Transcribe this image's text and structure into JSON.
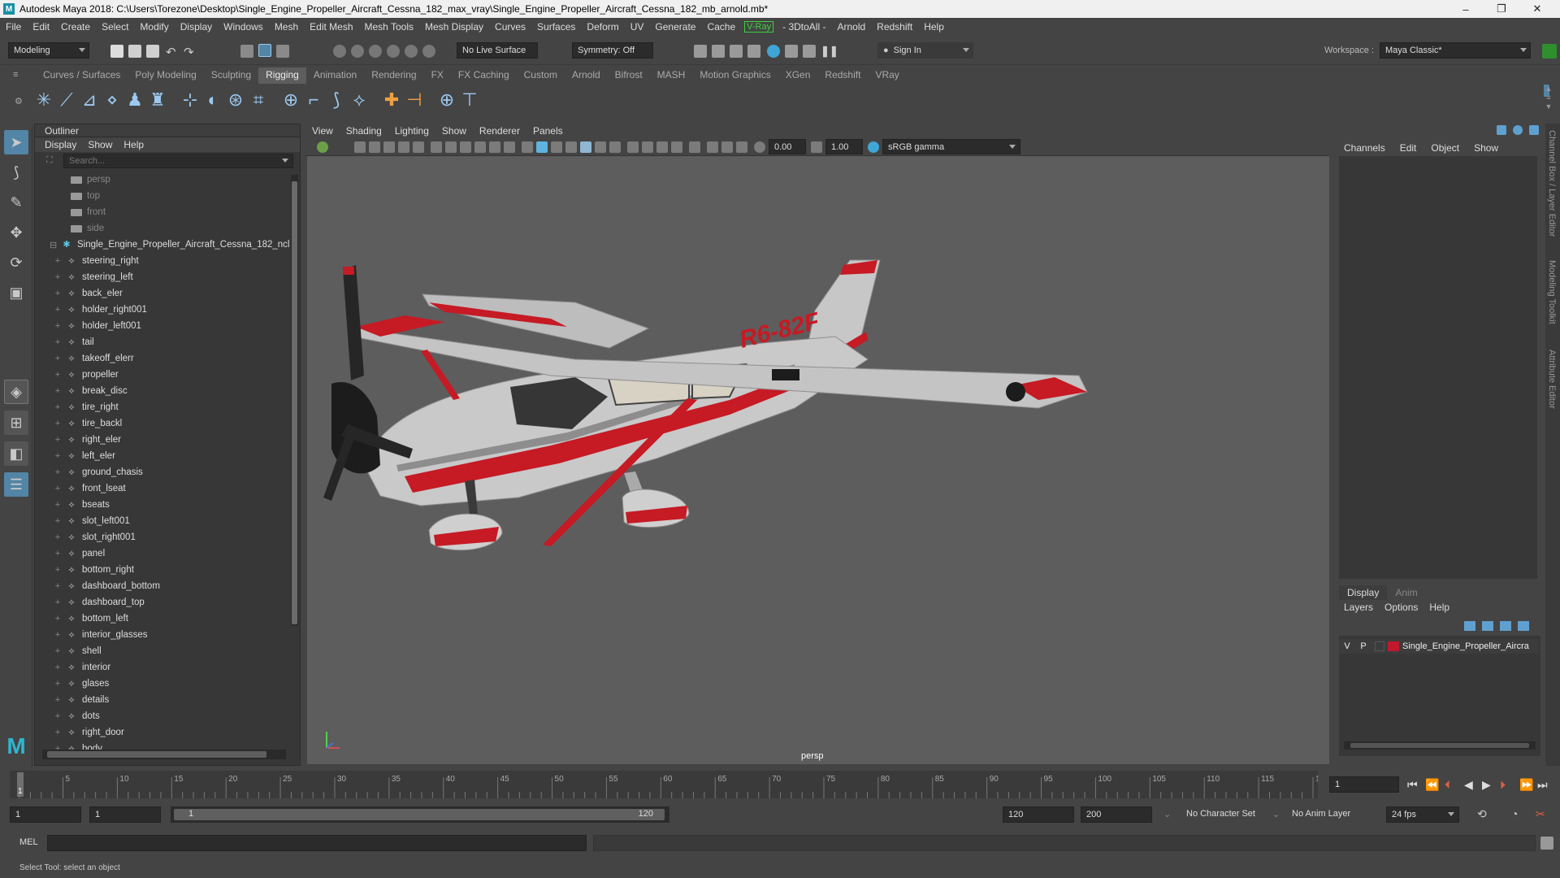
{
  "window": {
    "title": "Autodesk Maya 2018: C:\\Users\\Torezone\\Desktop\\Single_Engine_Propeller_Aircraft_Cessna_182_max_vray\\Single_Engine_Propeller_Aircraft_Cessna_182_mb_arnold.mb*",
    "minimize": "–",
    "restore": "❐",
    "close": "✕"
  },
  "menubar": {
    "items": [
      "File",
      "Edit",
      "Create",
      "Select",
      "Modify",
      "Display",
      "Windows",
      "Mesh",
      "Edit Mesh",
      "Mesh Tools",
      "Mesh Display",
      "Curves",
      "Surfaces",
      "Deform",
      "UV",
      "Generate",
      "Cache"
    ],
    "vray": "V-Ray",
    "items2": [
      "- 3DtoAll -",
      "Arnold",
      "Redshift",
      "Help"
    ],
    "workspace_label": "Workspace :",
    "workspace_value": "Maya Classic*"
  },
  "statusline": {
    "mode": "Modeling",
    "live_surface": "No Live Surface",
    "symmetry": "Symmetry: Off",
    "sign_in": "Sign In"
  },
  "shelf": {
    "tabs": [
      "Curves / Surfaces",
      "Poly Modeling",
      "Sculpting",
      "Rigging",
      "Animation",
      "Rendering",
      "FX",
      "FX Caching",
      "Custom",
      "Arnold",
      "Bifrost",
      "MASH",
      "Motion Graphics",
      "XGen",
      "Redshift",
      "VRay"
    ],
    "active_tab": "Rigging",
    "icons": [
      "joint-tool-icon",
      "insert-joint-icon",
      "mirror-joint-icon",
      "orient-joint-icon",
      "quick-rig-icon",
      "humanik-icon",
      "bind-skin-icon",
      "paint-weights-icon",
      "smooth-bind-icon",
      "lattice-icon",
      "cluster-icon",
      "ik-handle-icon",
      "ik-spline-icon",
      "ik-spring-icon",
      "point-constraint-icon",
      "aim-constraint-icon",
      "parent-constraint-icon",
      "locator-icon"
    ]
  },
  "outliner": {
    "title": "Outliner",
    "menu": [
      "Display",
      "Show",
      "Help"
    ],
    "search_placeholder": "Search...",
    "cameras": [
      "persp",
      "top",
      "front",
      "side"
    ],
    "group": "Single_Engine_Propeller_Aircraft_Cessna_182_ncl",
    "children": [
      "steering_right",
      "steering_left",
      "back_eler",
      "holder_right001",
      "holder_left001",
      "tail",
      "takeoff_elerr",
      "propeller",
      "break_disc",
      "tire_right",
      "tire_backl",
      "right_eler",
      "left_eler",
      "ground_chasis",
      "front_lseat",
      "bseats",
      "slot_left001",
      "slot_right001",
      "panel",
      "bottom_right",
      "dashboard_bottom",
      "dashboard_top",
      "bottom_left",
      "interior_glasses",
      "shell",
      "interior",
      "glases",
      "details",
      "dots",
      "right_door",
      "body"
    ]
  },
  "viewport": {
    "menu": [
      "View",
      "Shading",
      "Lighting",
      "Show",
      "Renderer",
      "Panels"
    ],
    "exposure": "0.00",
    "gamma": "1.00",
    "color_space": "sRGB gamma",
    "camera_label": "persp",
    "tail_number": "R6-82F"
  },
  "channelbox": {
    "menu": [
      "Channels",
      "Edit",
      "Object",
      "Show"
    ],
    "layer_tabs": [
      "Display",
      "Anim"
    ],
    "active_layer_tab": "Display",
    "layer_menu": [
      "Layers",
      "Options",
      "Help"
    ],
    "layer": {
      "v": "V",
      "p": "P",
      "name": "Single_Engine_Propeller_Aircra",
      "color": "#c0192c"
    },
    "side_tabs": [
      "Channel Box / Layer Editor",
      "Modeling Toolkit",
      "Attribute Editor"
    ]
  },
  "timeline": {
    "ticks": [
      "5",
      "10",
      "15",
      "20",
      "25",
      "30",
      "35",
      "40",
      "45",
      "50",
      "55",
      "60",
      "65",
      "70",
      "75",
      "80",
      "85",
      "90",
      "95",
      "100",
      "105",
      "110",
      "115",
      "120"
    ],
    "current_frame": "1",
    "current_marker": "1"
  },
  "range": {
    "start": "1",
    "playback_start": "1",
    "slider_start": "1",
    "slider_end": "120",
    "playback_end": "120",
    "end": "200",
    "character_set": "No Character Set",
    "anim_layer": "No Anim Layer",
    "fps": "24 fps"
  },
  "cmdline": {
    "label": "MEL"
  },
  "helpline": {
    "text": "Select Tool: select an object"
  },
  "colors": {
    "accent": "#5285a6",
    "plane_red": "#c61a24",
    "plane_white": "#c9c9c9"
  }
}
